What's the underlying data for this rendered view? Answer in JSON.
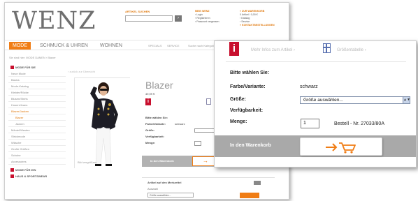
{
  "header": {
    "logo": "WENZ",
    "search_label": "ARTIKEL SUCHEN",
    "search_btn": "›",
    "col1": {
      "title": "MEIN WENZ",
      "lines": [
        "› Login",
        "› Registrieren",
        "› Passwort vergessen"
      ]
    },
    "col2": {
      "title": "» ZUR WARENKORB",
      "lines": [
        "0 Artikel / 0,00 €",
        "› Katalog",
        "› Service",
        "» KONTAKTBESTELLUNGEN"
      ]
    }
  },
  "nav": {
    "items": [
      "MODE",
      "SCHMUCK & UHREN",
      "WOHNEN",
      "SPECIALS",
      "SERVICE"
    ],
    "extra": "Suche nach Kategorie"
  },
  "breadcrumb": "Sie sind hier: MODE DAMEN › Blazer",
  "breadcrumb2": "‹ zurück zur Übersicht",
  "sidebar": {
    "head": "MODE FÜR SIE",
    "items": [
      "Neue Mode",
      "Basics",
      "Mode-Katalog",
      "Kleider/Röcke",
      "Blusen/Shirts",
      "Hosen/Jeans",
      "Blazer/Jacken",
      "Blazer",
      "Jacken",
      "Mäntel/Westen",
      "Strickmode",
      "Wäsche",
      "Große Größen",
      "Schuhe",
      "Accessoires"
    ],
    "foot1": "MODE FÜR IHN",
    "foot2": "HAUS & SPORTSWEAR"
  },
  "product": {
    "zoom_label": "Bild vergrößern",
    "title": "Blazer",
    "price": "49,99 €",
    "logo_char": "i",
    "form_labels": [
      "Bitte wählen Sie:",
      "Farbe/Variante:",
      "Größe:",
      "Verfügbarkeit:",
      "Menge:"
    ],
    "form_values": [
      "",
      "schwarz",
      "Größe auswählen...",
      "",
      "1"
    ],
    "cart_label": "In den Warenkorb",
    "notify_title": "Artikel auf den Merkzettel",
    "notify_sub": "Auswahl",
    "notify_select": "Größe auswählen..."
  },
  "popup": {
    "logo_char": "i",
    "toplink1": "Mehr Infos zum Artikel ›",
    "toplink2": "Größentabelle ›",
    "label_choose": "Bitte wählen Sie:",
    "label_color": "Farbe/Variante:",
    "value_color": "schwarz",
    "label_size": "Größe:",
    "size_select": "Größe auswählen...",
    "label_avail": "Verfügbarkeit:",
    "label_qty": "Menge:",
    "qty_value": "1",
    "order_nr": "Bestell - Nr. 27033/80A",
    "cart_label": "In den Warenkorb",
    "cart_icon": "arrow-to-cart-icon"
  },
  "colors": {
    "accent": "#f07d15",
    "brand_red": "#c8102e",
    "cart_bar": "#a9a9a9"
  }
}
